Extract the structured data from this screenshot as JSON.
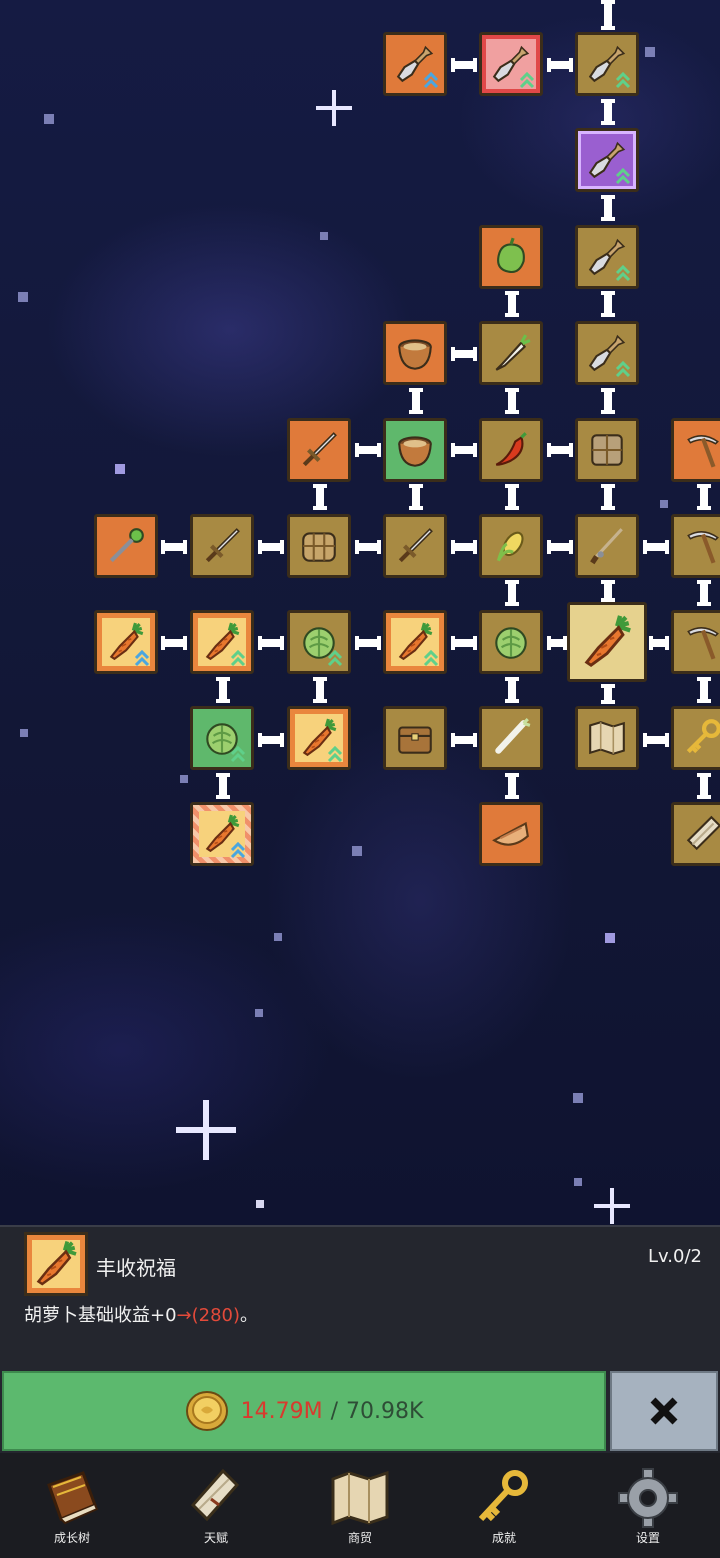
{
  "colors": {
    "node_orange": "#e07a3a",
    "node_tan": "#a88a43",
    "node_green": "#5fb86c",
    "node_purple": "#9a5fd0",
    "node_gold": "#f7d27c",
    "buy_button": "#5cb96e",
    "cost_have": "#d83a2e",
    "close_button": "#a6b2bf"
  },
  "skill_tree": {
    "nodes": [
      {
        "icon": "shovel-icon",
        "style": "orange"
      },
      {
        "icon": "shovel-icon",
        "style": "pink"
      },
      {
        "icon": "shovel-icon",
        "style": "tan"
      },
      {
        "icon": "shovel-icon",
        "style": "purple"
      },
      {
        "icon": "bell-pepper-icon",
        "style": "orange"
      },
      {
        "icon": "shovel-icon",
        "style": "tan"
      },
      {
        "icon": "bowl-icon",
        "style": "orange"
      },
      {
        "icon": "radish-icon",
        "style": "tan"
      },
      {
        "icon": "shovel-icon",
        "style": "tan"
      },
      {
        "icon": "sword-icon",
        "style": "orange"
      },
      {
        "icon": "bowl-icon",
        "style": "green"
      },
      {
        "icon": "chili-icon",
        "style": "tan"
      },
      {
        "icon": "sack-icon",
        "style": "tan"
      },
      {
        "icon": "pickaxe-icon",
        "style": "orange"
      },
      {
        "icon": "staff-icon",
        "style": "orange"
      },
      {
        "icon": "sword-icon",
        "style": "tan"
      },
      {
        "icon": "basket-icon",
        "style": "tan"
      },
      {
        "icon": "sword-icon",
        "style": "tan"
      },
      {
        "icon": "corn-icon",
        "style": "tan"
      },
      {
        "icon": "fishing-rod-icon",
        "style": "tan"
      },
      {
        "icon": "pickaxe-icon",
        "style": "tan"
      },
      {
        "icon": "carrot-icon",
        "style": "gold"
      },
      {
        "icon": "carrot-icon",
        "style": "gold"
      },
      {
        "icon": "cabbage-icon",
        "style": "tan"
      },
      {
        "icon": "carrot-icon",
        "style": "gold"
      },
      {
        "icon": "cabbage-icon",
        "style": "tan"
      },
      {
        "icon": "carrot-icon",
        "style": "selected"
      },
      {
        "icon": "pickaxe-icon",
        "style": "tan"
      },
      {
        "icon": "cabbage-icon",
        "style": "green"
      },
      {
        "icon": "carrot-icon",
        "style": "gold"
      },
      {
        "icon": "treasure-chest-icon",
        "style": "tan"
      },
      {
        "icon": "leek-icon",
        "style": "tan"
      },
      {
        "icon": "map-icon",
        "style": "tan"
      },
      {
        "icon": "key-icon",
        "style": "tan"
      },
      {
        "icon": "carrot-icon",
        "style": "striped"
      },
      {
        "icon": "pie-icon",
        "style": "orange"
      },
      {
        "icon": "scroll-icon",
        "style": "tan"
      }
    ]
  },
  "detail_panel": {
    "icon": "carrot-icon",
    "name": "丰收祝福",
    "level": "Lv.0/2",
    "desc_prefix": "胡萝卜基础收益+0",
    "desc_arrow": "→(280)",
    "desc_suffix": "。"
  },
  "purchase": {
    "coin_icon": "gold-coin-icon",
    "have": "14.79M",
    "separator": "/",
    "need": "70.98K"
  },
  "close_button": {
    "icon": "close-icon"
  },
  "bottom_nav": [
    {
      "label": "成长树",
      "icon": "book-icon"
    },
    {
      "label": "天赋",
      "icon": "scroll-icon"
    },
    {
      "label": "商贸",
      "icon": "map-icon"
    },
    {
      "label": "成就",
      "icon": "key-icon"
    },
    {
      "label": "设置",
      "icon": "gear-icon"
    }
  ]
}
